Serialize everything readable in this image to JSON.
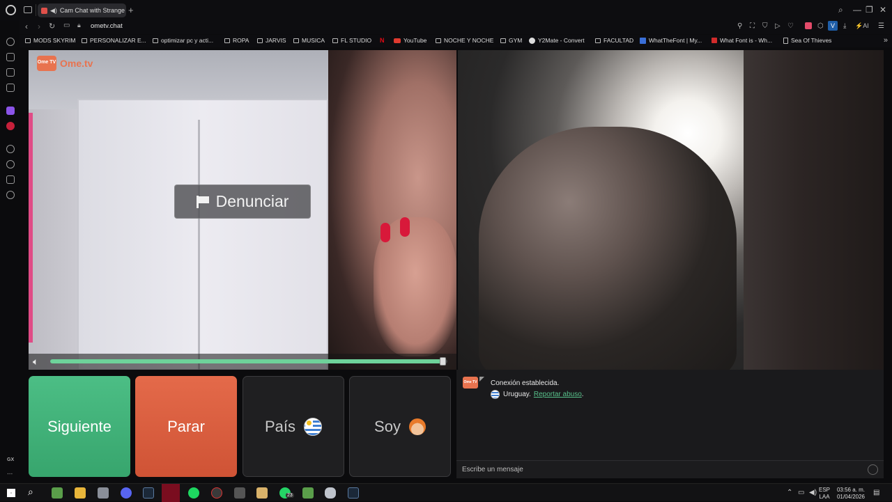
{
  "browser": {
    "tab_title": "Cam Chat with Strange",
    "url": "ometv.chat"
  },
  "bookmarks": [
    {
      "label": "MODS SKYRIM",
      "icon": "folder-icon"
    },
    {
      "label": "PERSONALIZAR E...",
      "icon": "folder-icon"
    },
    {
      "label": "optimizar pc y acti...",
      "icon": "folder-icon"
    },
    {
      "label": "ROPA",
      "icon": "folder-icon"
    },
    {
      "label": "JARVIS",
      "icon": "folder-icon"
    },
    {
      "label": "MUSICA",
      "icon": "folder-icon"
    },
    {
      "label": "FL STUDIO",
      "icon": "folder-icon"
    },
    {
      "label": "",
      "icon": "netflix-icon"
    },
    {
      "label": "YouTube",
      "icon": "youtube-icon"
    },
    {
      "label": "NOCHE Y NOCHE",
      "icon": "folder-icon"
    },
    {
      "label": "GYM",
      "icon": "folder-icon"
    },
    {
      "label": "Y2Mate - Convert",
      "icon": "y2mate-icon"
    },
    {
      "label": "FACULTAD",
      "icon": "folder-icon"
    },
    {
      "label": "WhatTheFont | My...",
      "icon": "whatthefont-icon"
    },
    {
      "label": "What Font is - Wh...",
      "icon": "whatfontis-icon"
    },
    {
      "label": "Sea Of Thieves",
      "icon": "page-icon"
    }
  ],
  "site": {
    "logo_text": "Ome.tv",
    "logo_badge": "Ome TV",
    "report_button": "Denunciar",
    "volume_level": 0.99
  },
  "buttons": {
    "next": "Siguiente",
    "stop": "Parar",
    "country": "País",
    "gender": "Soy"
  },
  "chat": {
    "connected": "Conexión establecida.",
    "country": "Uruguay.",
    "report_abuse": "Reportar abuso",
    "period": ".",
    "input_placeholder": "Escribe un mensaje"
  },
  "sidebar": {
    "gx_label": "GX",
    "more": "..."
  },
  "taskbar": {
    "lang_top": "ESP",
    "lang_bottom": "LAA",
    "time": "03:56 a. m.",
    "date": "01/04/2026",
    "whatsapp_badge": "23"
  },
  "colors": {
    "next_green": "#45b87c",
    "stop_red": "#de6142",
    "link_green": "#57c08a",
    "brand_orange": "#e8734f"
  }
}
